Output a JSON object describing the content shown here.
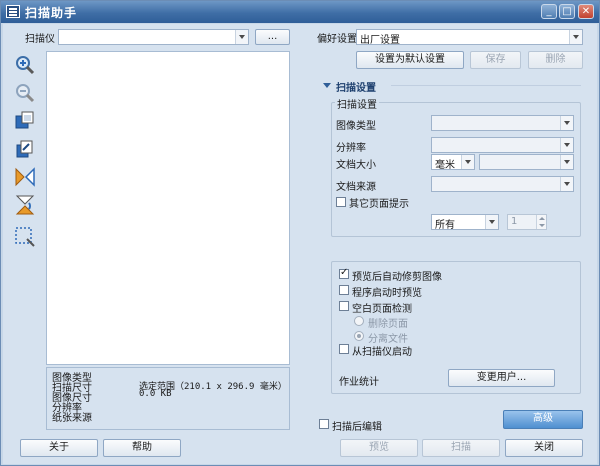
{
  "window": {
    "title": "扫描助手",
    "controls": {
      "minimize": "_",
      "restore": "□",
      "close": "✕"
    }
  },
  "scanner": {
    "label": "扫描仪",
    "value": "",
    "browse_label": "..."
  },
  "toolbar": {
    "icons": [
      "zoom-in-icon",
      "zoom-out-icon",
      "fit-page-icon",
      "rotate-icon",
      "flip-icon",
      "mirror-icon",
      "select-area-icon"
    ]
  },
  "info": {
    "labels": [
      "图像类型",
      "扫描尺寸",
      "图像尺寸",
      "分辨率",
      "纸张来源"
    ],
    "scan_size_value": "选定范围（210.1 x 296.9 毫米）",
    "image_size_value": "0.0 KB"
  },
  "preferences": {
    "label": "偏好设置",
    "value": "出厂设置",
    "set_default_label": "设置为默认设置",
    "save_label": "保存",
    "delete_label": "删除"
  },
  "scan_settings": {
    "section_title": "扫描设置",
    "group_title": "扫描设置",
    "image_type_label": "图像类型",
    "resolution_label": "分辨率",
    "doc_size_label": "文档大小",
    "unit_value": "毫米",
    "doc_source_label": "文档来源",
    "other_pages_label": "其它页面提示",
    "pages_value": "所有",
    "page_count": "1"
  },
  "options": {
    "auto_crop_label": "预览后自动修剪图像",
    "preview_on_start_label": "程序启动时预览",
    "blank_page_label": "空白页面检测",
    "delete_page_label": "删除页面",
    "separate_file_label": "分离文件",
    "start_from_scanner_label": "从扫描仪启动",
    "job_stats_label": "作业统计",
    "change_user_label": "变更用户..."
  },
  "bottom": {
    "edit_after_scan_label": "扫描后编辑",
    "advanced_label": "高级",
    "about_label": "关于",
    "help_label": "帮助",
    "preview_label": "预览",
    "scan_label": "扫描",
    "close_label": "关闭"
  },
  "colors": {
    "title_bar": "#3f6ea6",
    "background": "#d6e2ef",
    "accent": "#4f8fd0"
  }
}
